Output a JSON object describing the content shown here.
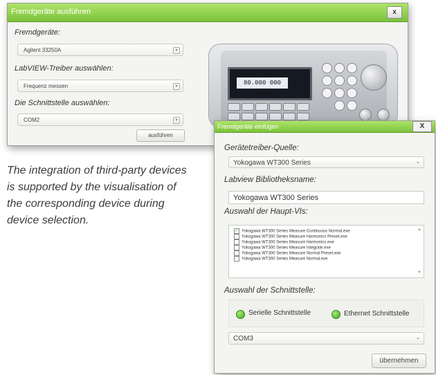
{
  "window1": {
    "title": "Fremdgeräte ausführen",
    "close_label": "x",
    "devices_label": "Fremdgeräte:",
    "device_value": "Agilent 33250A",
    "driver_label": "LabVIEW-Treiber auswählen:",
    "driver_value": "Frequenz messen",
    "interface_label": "Die Schnittstelle auswählen:",
    "interface_value": "COM2",
    "execute_button": "ausführen",
    "device_display": "80.000 000 MHz"
  },
  "window2": {
    "title": "Fremdgeräte einfügen",
    "close_label": "X",
    "source_label": "Gerätetreiber-Quelle:",
    "source_value": "Yokogawa WT300 Series",
    "library_label": "Labview Bibliotheksname:",
    "library_value": "Yokogawa WT300 Series",
    "main_vis_label": "Auswahl der Haupt-VIs:",
    "vis": [
      {
        "label": "Yokogawa WT300 Series Measure Continuous Normal.exe",
        "checked": true
      },
      {
        "label": "Yokogawa WT300 Series Measure Harmonics Preset.exe",
        "checked": false
      },
      {
        "label": "Yokogawa WT300 Series Measure Harmonics.exe",
        "checked": false
      },
      {
        "label": "Yokogawa WT300 Series Measure Integrate.exe",
        "checked": false
      },
      {
        "label": "Yokogawa WT300 Series Measure Normal Preset.exe",
        "checked": false
      },
      {
        "label": "Yokogawa WT300 Series Measure Normal.exe",
        "checked": false
      }
    ],
    "interface_label": "Auswahl der Schnittstelle:",
    "serial_label": "Serielle Schnittstelle",
    "ethernet_label": "Ethernet Schnittstelle",
    "port_value": "COM3",
    "apply_button": "übernehmen"
  },
  "caption": "The integration of third-party devices is supported by the visualisation of the corresponding device during device selection.",
  "colors": {
    "titlebar": "#8fd048",
    "radio": "#4caf20"
  }
}
